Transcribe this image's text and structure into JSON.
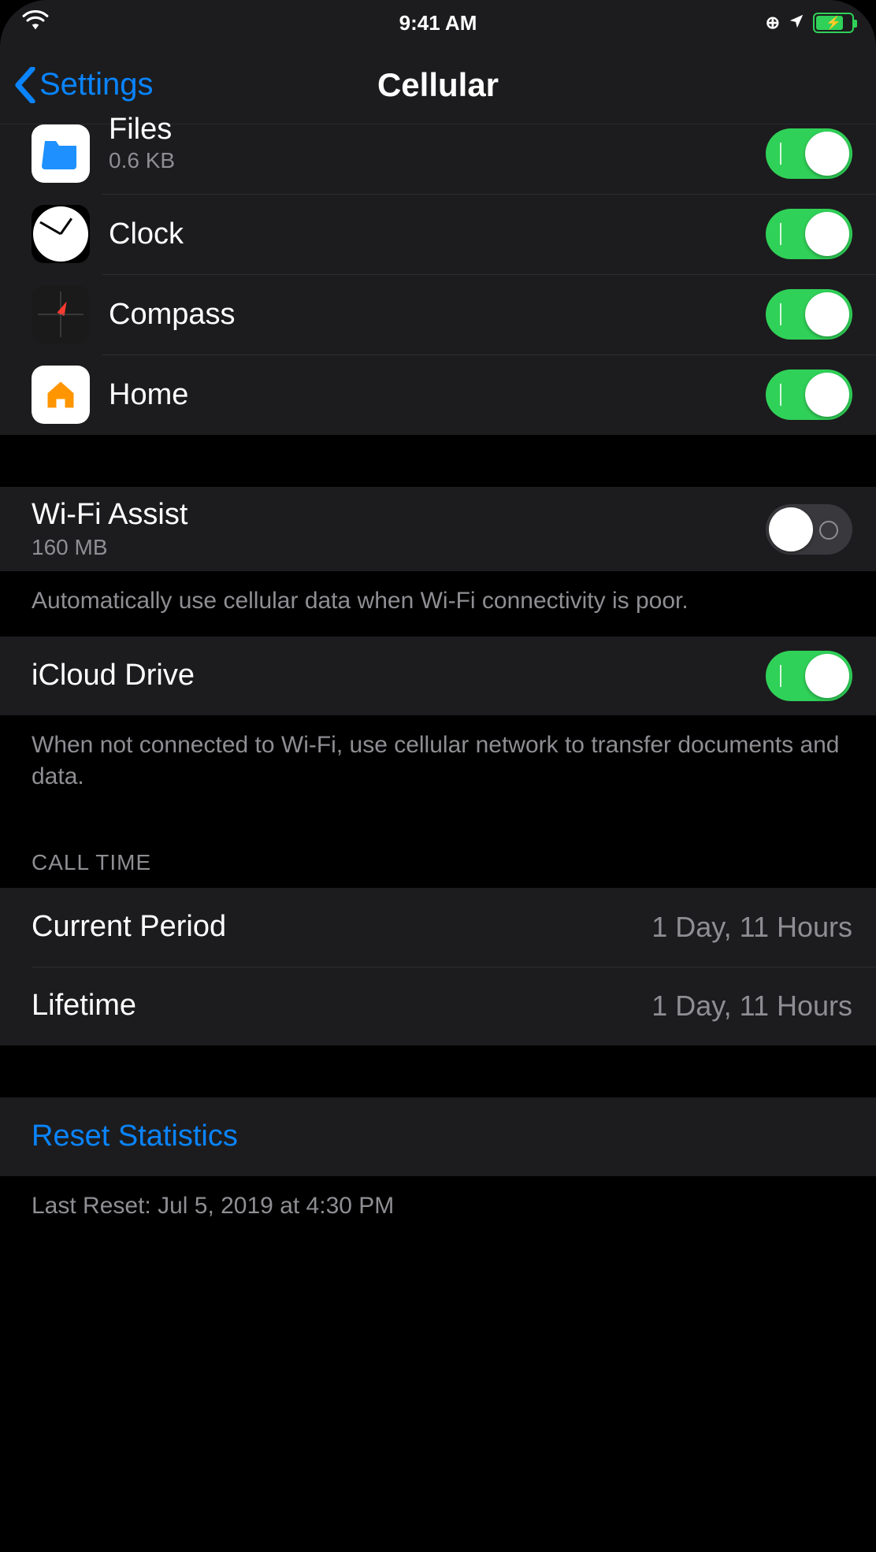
{
  "status": {
    "time": "9:41 AM"
  },
  "nav": {
    "back_label": "Settings",
    "title": "Cellular"
  },
  "apps": [
    {
      "id": "files",
      "name": "Files",
      "usage": "0.6 KB",
      "on": true
    },
    {
      "id": "clock",
      "name": "Clock",
      "usage": "",
      "on": true
    },
    {
      "id": "compass",
      "name": "Compass",
      "usage": "",
      "on": true
    },
    {
      "id": "home",
      "name": "Home",
      "usage": "",
      "on": true
    }
  ],
  "wifi_assist": {
    "title": "Wi-Fi Assist",
    "usage": "160 MB",
    "on": false,
    "footer": "Automatically use cellular data when Wi-Fi connectivity is poor."
  },
  "icloud_drive": {
    "title": "iCloud Drive",
    "on": true,
    "footer": "When not connected to Wi-Fi, use cellular network to transfer documents and data."
  },
  "call_time": {
    "header": "CALL TIME",
    "current_label": "Current Period",
    "current_value": "1 Day, 11 Hours",
    "lifetime_label": "Lifetime",
    "lifetime_value": "1 Day, 11 Hours"
  },
  "reset": {
    "label": "Reset Statistics",
    "last_reset": "Last Reset: Jul 5, 2019 at 4:30 PM"
  }
}
